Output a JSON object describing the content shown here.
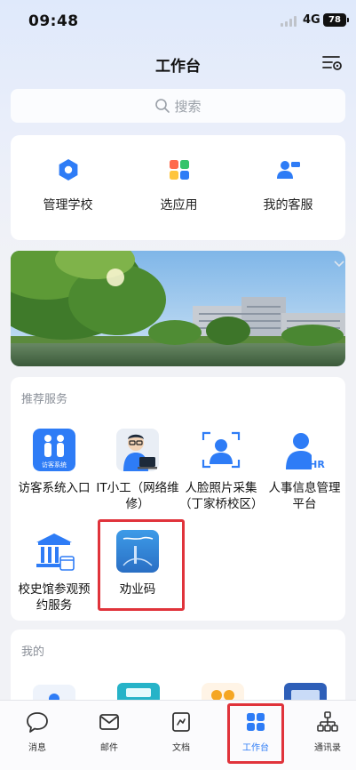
{
  "status": {
    "time": "09:48",
    "network": "4G",
    "battery": "78"
  },
  "header": {
    "title": "工作台"
  },
  "search": {
    "placeholder": "搜索"
  },
  "quick": [
    {
      "label": "管理学校",
      "icon": "hexagon-icon"
    },
    {
      "label": "选应用",
      "icon": "apps-grid-icon"
    },
    {
      "label": "我的客服",
      "icon": "customer-service-icon"
    }
  ],
  "recommend": {
    "title": "推荐服务",
    "items": [
      {
        "label": "访客系统入口",
        "icon_text": "访客系统"
      },
      {
        "label": "IT小工（网络维修）"
      },
      {
        "label": "人脸照片采集（丁家桥校区）"
      },
      {
        "label": "人事信息管理平台",
        "icon_text": "HR"
      },
      {
        "label": "校史馆参观预约服务"
      },
      {
        "label": "劝业码"
      }
    ]
  },
  "mine": {
    "title": "我的"
  },
  "tabbar": [
    {
      "label": "消息",
      "icon": "message-icon"
    },
    {
      "label": "邮件",
      "icon": "mail-icon"
    },
    {
      "label": "文档",
      "icon": "document-icon"
    },
    {
      "label": "工作台",
      "icon": "workbench-icon",
      "active": true
    },
    {
      "label": "通讯录",
      "icon": "contacts-icon"
    }
  ],
  "colors": {
    "accent": "#2e7cf6",
    "highlight": "#e0333b"
  }
}
